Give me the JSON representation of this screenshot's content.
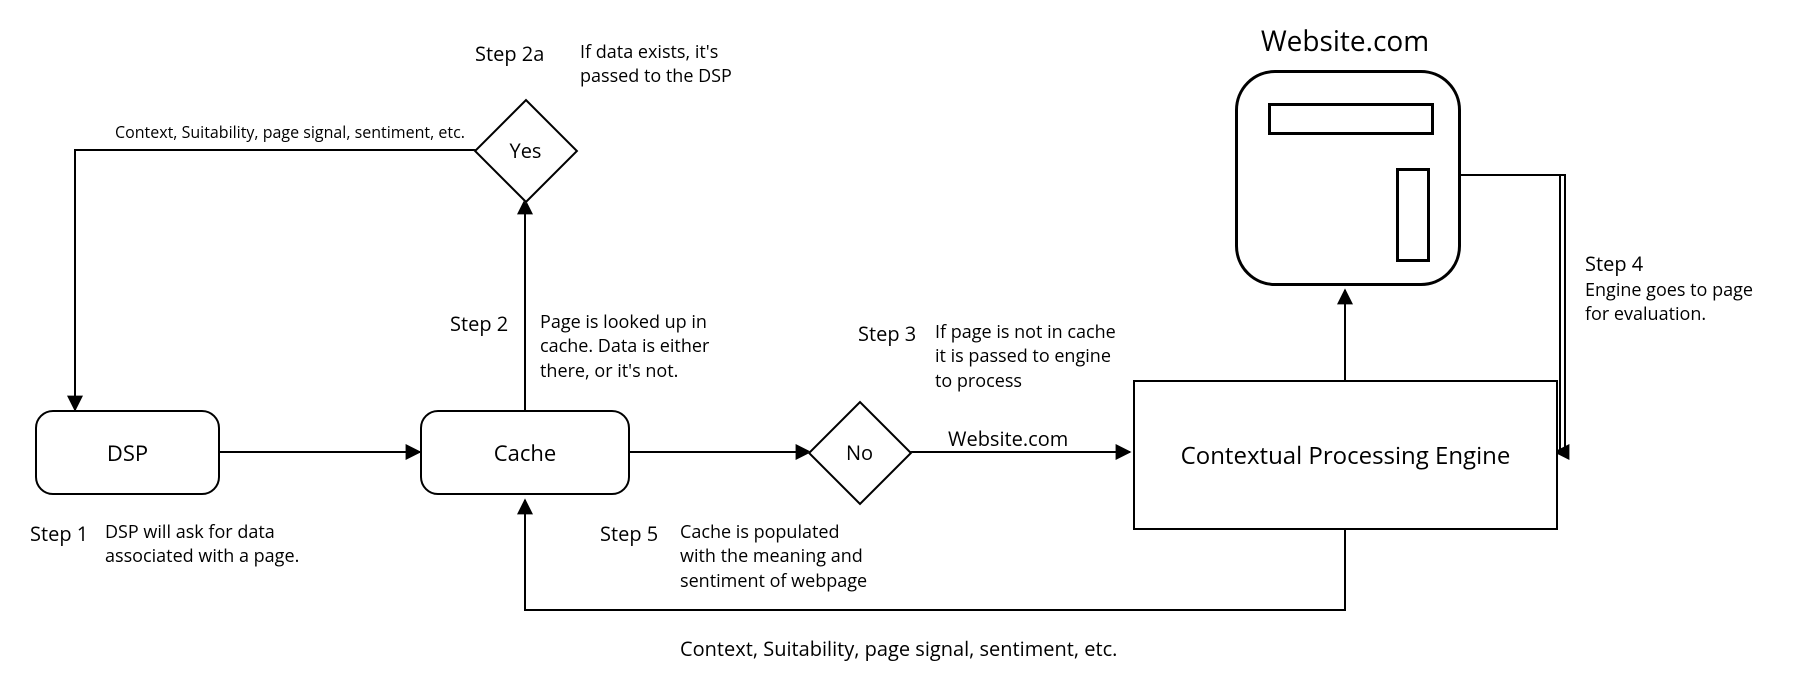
{
  "nodes": {
    "dsp": "DSP",
    "cache": "Cache",
    "yes": "Yes",
    "no": "No",
    "engine": "Contextual Processing Engine",
    "website_title": "Website.com"
  },
  "steps": {
    "s1_title": "Step 1",
    "s1_desc": "DSP will ask for data associated with a page.",
    "s2_title": "Step 2",
    "s2_desc": "Page is looked up in cache. Data is either there, or it's not.",
    "s2a_title": "Step 2a",
    "s2a_desc": "If data exists, it's passed to the DSP",
    "s3_title": "Step 3",
    "s3_desc": "If page is not in cache it is passed to engine to process",
    "s4_title": "Step 4",
    "s4_desc": "Engine goes to page for evaluation.",
    "s5_title": "Step 5",
    "s5_desc": "Cache is populated with the meaning and sentiment of webpage"
  },
  "edge_labels": {
    "context_top": "Context, Suitability, page signal, sentiment, etc.",
    "website_label": "Website.com",
    "context_bottom": "Context, Suitability, page signal, sentiment, etc."
  }
}
